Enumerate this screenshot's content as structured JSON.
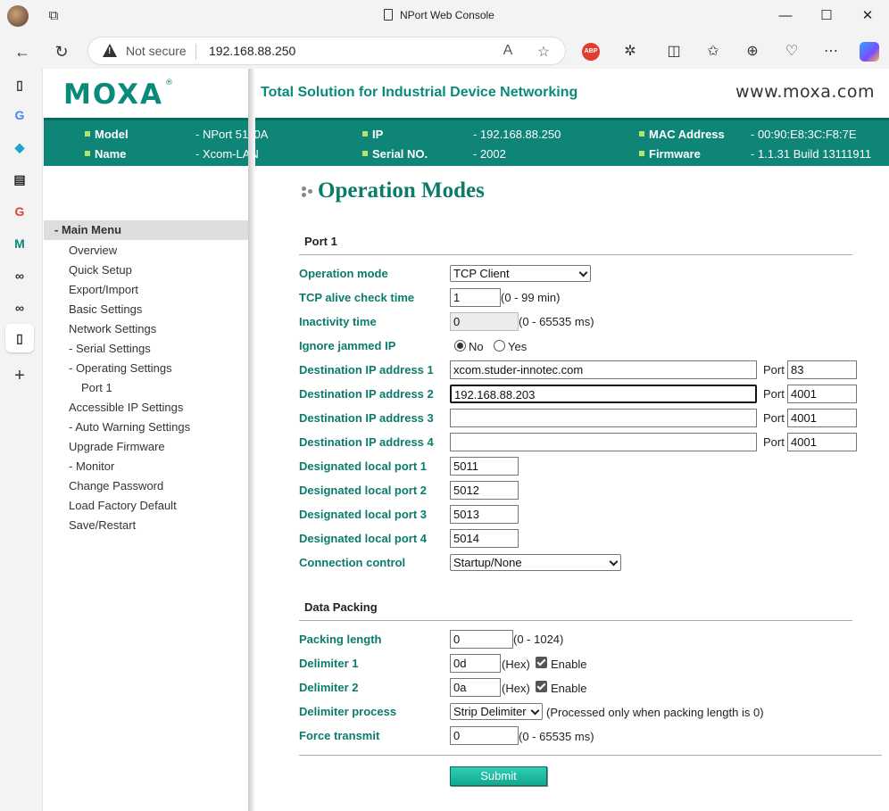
{
  "window": {
    "title": "NPort Web Console"
  },
  "browser": {
    "security_label": "Not secure",
    "url": "192.168.88.250",
    "abp_label": "ABP"
  },
  "header": {
    "logo": "MOXA",
    "logo_mark": "®",
    "slogan": "Total Solution for Industrial Device Networking",
    "site": "www.moxa.com"
  },
  "info": {
    "model_key": "Model",
    "model_val": "- NPort 5110A",
    "name_key": "Name",
    "name_val": "- Xcom-LAN",
    "ip_key": "IP",
    "ip_val": "- 192.168.88.250",
    "serial_key": "Serial NO.",
    "serial_val": "- 2002",
    "mac_key": "MAC Address",
    "mac_val": "- 00:90:E8:3C:F8:7E",
    "fw_key": "Firmware",
    "fw_val": "- 1.1.31 Build 13111911"
  },
  "menu": {
    "head": "- Main Menu",
    "items": [
      "Overview",
      "Quick Setup",
      "Export/Import",
      "Basic Settings",
      "Network Settings",
      "- Serial Settings",
      "- Operating Settings",
      "Port 1",
      "Accessible IP Settings",
      "- Auto Warning Settings",
      "Upgrade Firmware",
      "- Monitor",
      "Change Password",
      "Load Factory Default",
      "Save/Restart"
    ]
  },
  "form": {
    "title": "Operation Modes",
    "port_section": "Port 1",
    "packing_section": "Data Packing",
    "labels": {
      "op_mode": "Operation mode",
      "tcp_alive": "TCP alive check time",
      "inactivity": "Inactivity time",
      "ignore_jammed": "Ignore jammed IP",
      "dest1": "Destination IP address 1",
      "dest2": "Destination IP address 2",
      "dest3": "Destination IP address 3",
      "dest4": "Destination IP address 4",
      "local1": "Designated local port 1",
      "local2": "Designated local port 2",
      "local3": "Designated local port 3",
      "local4": "Designated local port 4",
      "conn_ctrl": "Connection control",
      "packing_len": "Packing length",
      "delim1": "Delimiter 1",
      "delim2": "Delimiter 2",
      "delim_proc": "Delimiter process",
      "force_tx": "Force transmit"
    },
    "values": {
      "op_mode": "TCP Client",
      "tcp_alive": "1",
      "inactivity": "0",
      "dest1": "xcom.studer-innotec.com",
      "dest2": "192.168.88.203",
      "dest3": "",
      "dest4": "",
      "port1": "83",
      "port2": "4001",
      "port3": "4001",
      "port4": "4001",
      "local1": "5011",
      "local2": "5012",
      "local3": "5013",
      "local4": "5014",
      "conn_ctrl": "Startup/None",
      "packing_len": "0",
      "delim1": "0d",
      "delim2": "0a",
      "delim_proc": "Strip Delimiter",
      "force_tx": "0"
    },
    "hints": {
      "tcp_alive": "(0 - 99 min)",
      "inactivity": "(0 - 65535 ms)",
      "packing_len": "(0 - 1024)",
      "hex": "(Hex)",
      "enable": "Enable",
      "delim_proc": "(Processed only when packing length is 0)",
      "force_tx": "(0 - 65535 ms)"
    },
    "radio": {
      "no": "No",
      "yes": "Yes",
      "selected": "No"
    },
    "port_label": "Port",
    "submit": "Submit"
  }
}
